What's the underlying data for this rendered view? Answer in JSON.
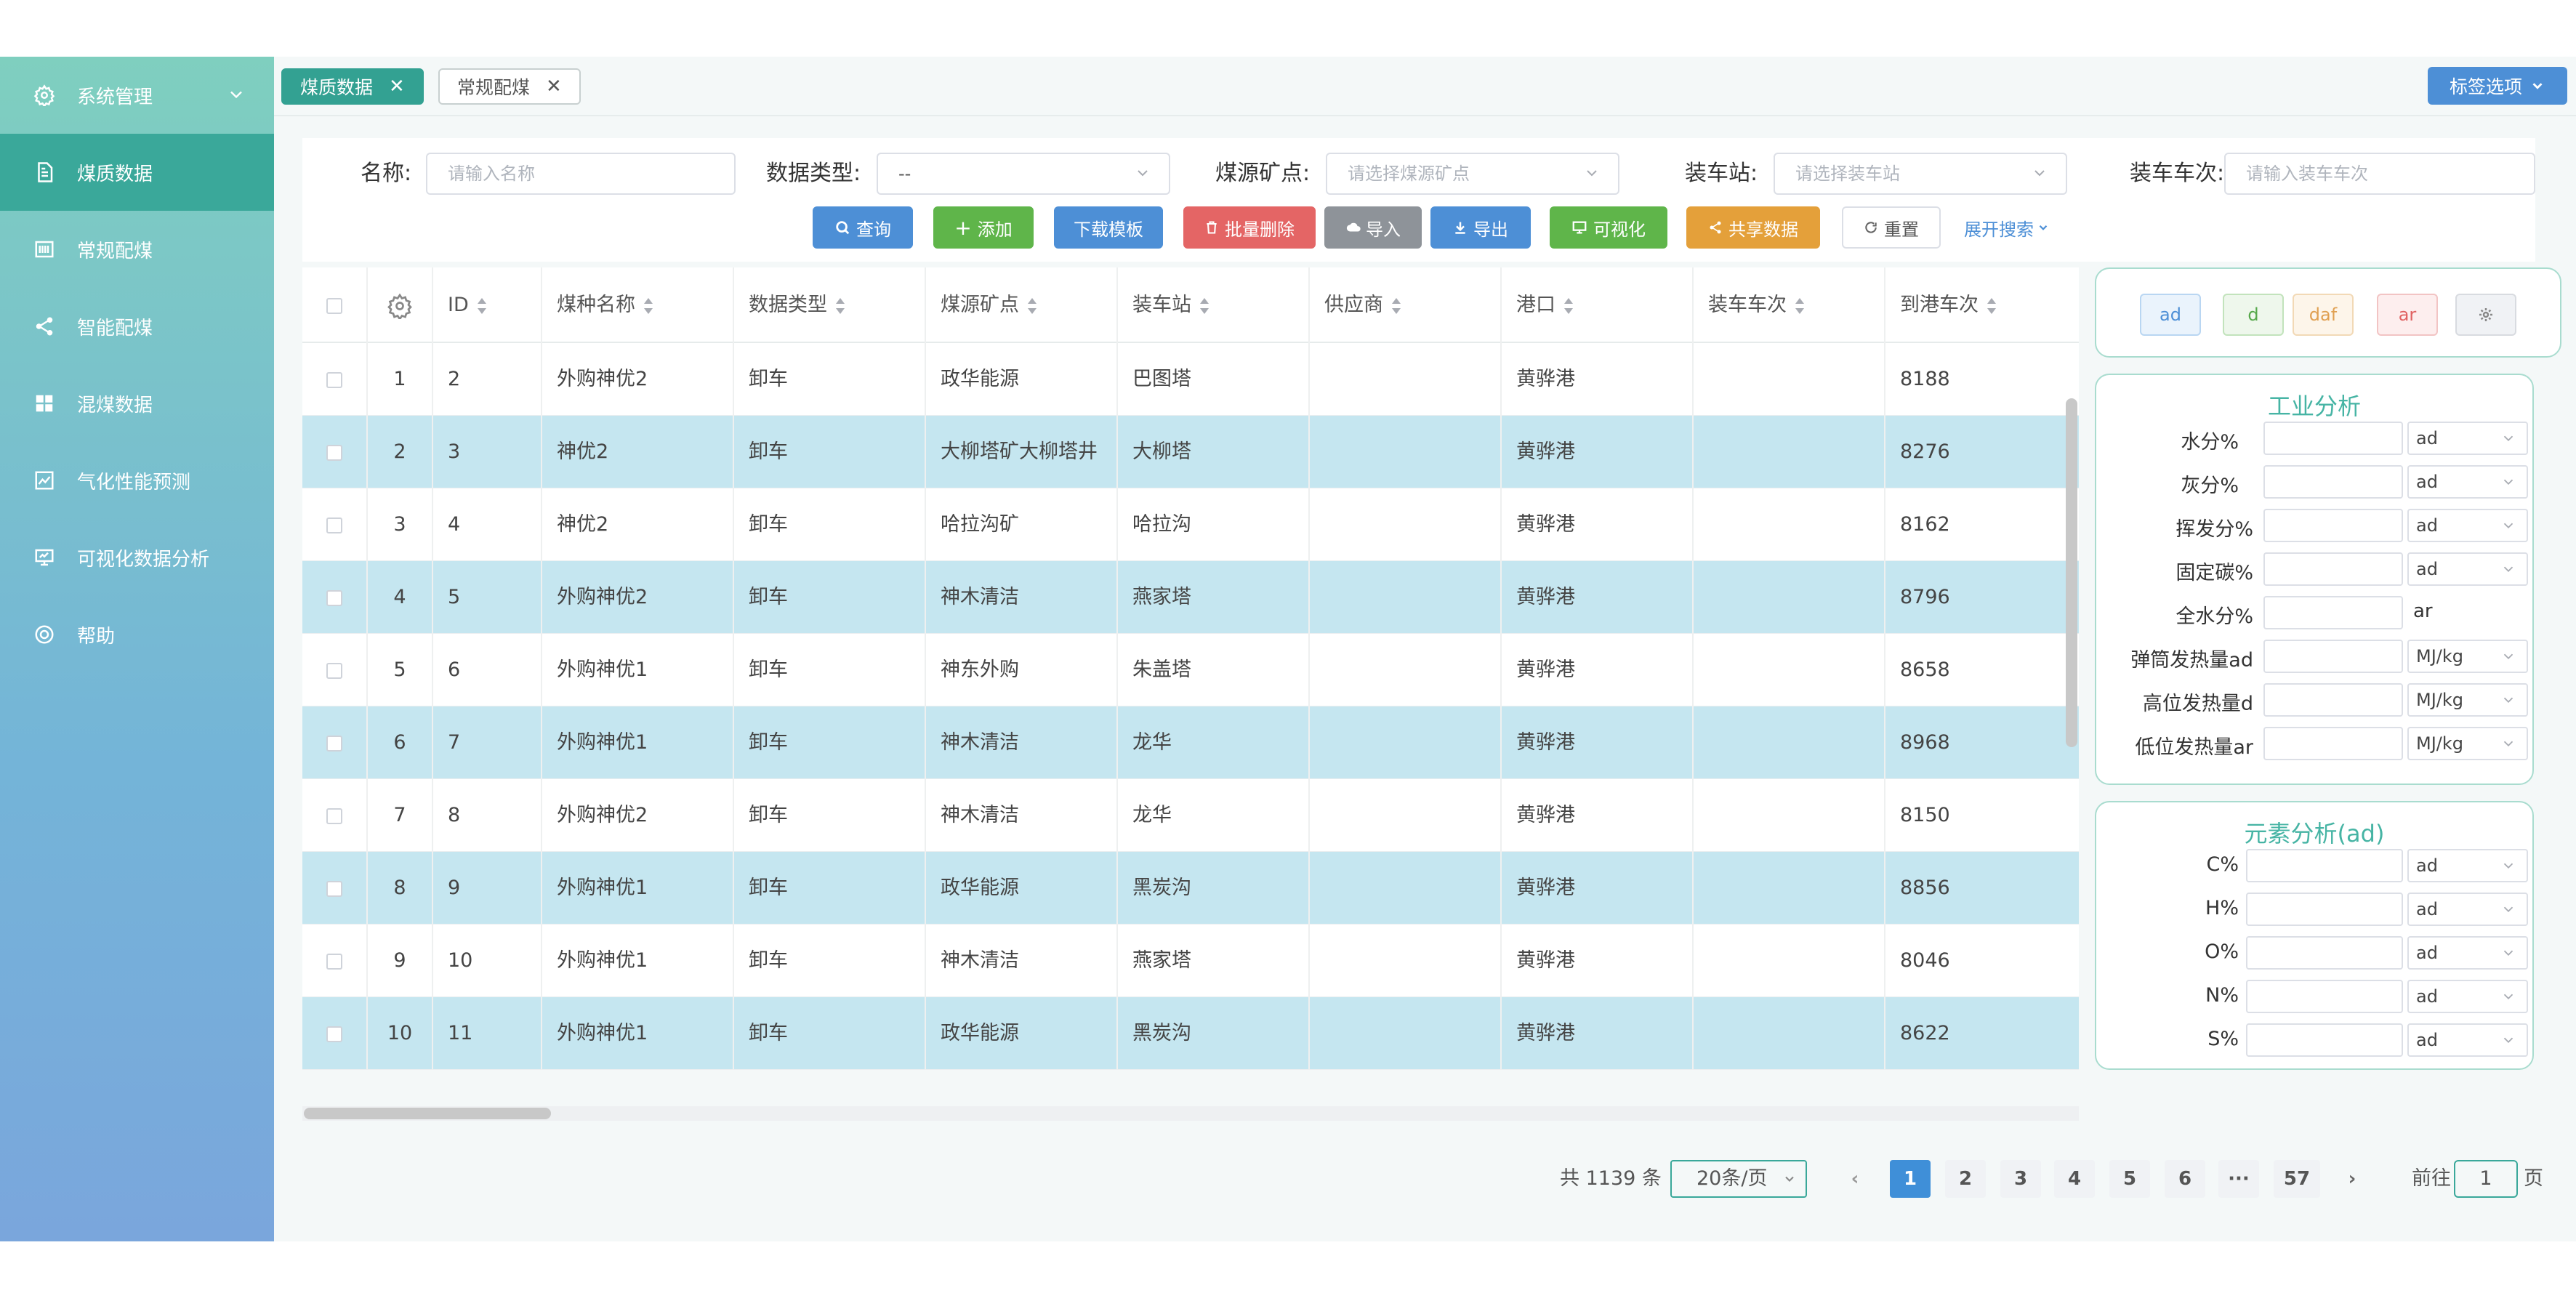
{
  "sidebar": {
    "items": [
      {
        "label": "系统管理",
        "icon": "gear-icon",
        "active": false
      },
      {
        "label": "煤质数据",
        "icon": "document-icon",
        "active": true
      },
      {
        "label": "常规配煤",
        "icon": "barcode-icon",
        "active": false
      },
      {
        "label": "智能配煤",
        "icon": "share-icon",
        "active": false
      },
      {
        "label": "混煤数据",
        "icon": "grid-icon",
        "active": false
      },
      {
        "label": "气化性能预测",
        "icon": "chart-icon",
        "active": false
      },
      {
        "label": "可视化数据分析",
        "icon": "monitor-icon",
        "active": false
      },
      {
        "label": "帮助",
        "icon": "help-icon",
        "active": false
      }
    ]
  },
  "tabs": [
    {
      "label": "煤质数据",
      "active": true
    },
    {
      "label": "常规配煤",
      "active": false
    }
  ],
  "tag_options_label": "标签选项",
  "search": {
    "name_label": "名称:",
    "name_placeholder": "请输入名称",
    "type_label": "数据类型:",
    "type_value": "--",
    "mine_label": "煤源矿点:",
    "mine_placeholder": "请选择煤源矿点",
    "station_label": "装车站:",
    "station_placeholder": "请选择装车站",
    "train_label": "装车车次:",
    "train_placeholder": "请输入装车车次"
  },
  "buttons": {
    "query": "查询",
    "add": "添加",
    "download": "下载模板",
    "batch_delete": "批量删除",
    "import": "导入",
    "export": "导出",
    "visualize": "可视化",
    "share": "共享数据",
    "reset": "重置",
    "expand": "展开搜索"
  },
  "table": {
    "headers": [
      "ID",
      "煤种名称",
      "数据类型",
      "煤源矿点",
      "装车站",
      "供应商",
      "港口",
      "装车车次",
      "到港车次"
    ],
    "rows": [
      {
        "idx": "1",
        "id": "2",
        "name": "外购神优2",
        "type": "卸车",
        "mine": "政华能源",
        "station": "巴图塔",
        "supplier": "",
        "port": "黄骅港",
        "train": "",
        "arrival": "8188"
      },
      {
        "idx": "2",
        "id": "3",
        "name": "神优2",
        "type": "卸车",
        "mine": "大柳塔矿大柳塔井",
        "station": "大柳塔",
        "supplier": "",
        "port": "黄骅港",
        "train": "",
        "arrival": "8276"
      },
      {
        "idx": "3",
        "id": "4",
        "name": "神优2",
        "type": "卸车",
        "mine": "哈拉沟矿",
        "station": "哈拉沟",
        "supplier": "",
        "port": "黄骅港",
        "train": "",
        "arrival": "8162"
      },
      {
        "idx": "4",
        "id": "5",
        "name": "外购神优2",
        "type": "卸车",
        "mine": "神木清洁",
        "station": "燕家塔",
        "supplier": "",
        "port": "黄骅港",
        "train": "",
        "arrival": "8796"
      },
      {
        "idx": "5",
        "id": "6",
        "name": "外购神优1",
        "type": "卸车",
        "mine": "神东外购",
        "station": "朱盖塔",
        "supplier": "",
        "port": "黄骅港",
        "train": "",
        "arrival": "8658"
      },
      {
        "idx": "6",
        "id": "7",
        "name": "外购神优1",
        "type": "卸车",
        "mine": "神木清洁",
        "station": "龙华",
        "supplier": "",
        "port": "黄骅港",
        "train": "",
        "arrival": "8968"
      },
      {
        "idx": "7",
        "id": "8",
        "name": "外购神优2",
        "type": "卸车",
        "mine": "神木清洁",
        "station": "龙华",
        "supplier": "",
        "port": "黄骅港",
        "train": "",
        "arrival": "8150"
      },
      {
        "idx": "8",
        "id": "9",
        "name": "外购神优1",
        "type": "卸车",
        "mine": "政华能源",
        "station": "黑炭沟",
        "supplier": "",
        "port": "黄骅港",
        "train": "",
        "arrival": "8856"
      },
      {
        "idx": "9",
        "id": "10",
        "name": "外购神优1",
        "type": "卸车",
        "mine": "神木清洁",
        "station": "燕家塔",
        "supplier": "",
        "port": "黄骅港",
        "train": "",
        "arrival": "8046"
      },
      {
        "idx": "10",
        "id": "11",
        "name": "外购神优1",
        "type": "卸车",
        "mine": "政华能源",
        "station": "黑炭沟",
        "supplier": "",
        "port": "黄骅港",
        "train": "",
        "arrival": "8622"
      }
    ]
  },
  "pagination": {
    "total": "共 1139 条",
    "page_size": "20条/页",
    "pages": [
      "1",
      "2",
      "3",
      "4",
      "5",
      "6",
      "···",
      "57"
    ],
    "current": "1",
    "goto_label": "前往",
    "goto_value": "1",
    "page_suffix": "页"
  },
  "basis_buttons": [
    {
      "label": "ad",
      "color": "#4d8fd6",
      "bg": "#eaf3fc",
      "border": "#b9d6f2"
    },
    {
      "label": "d",
      "color": "#55a84a",
      "bg": "#eef7ec",
      "border": "#c2e3bc"
    },
    {
      "label": "daf",
      "color": "#e0a052",
      "bg": "#fdf5ea",
      "border": "#f2d9b6"
    },
    {
      "label": "ar",
      "color": "#e06262",
      "bg": "#fdeeee",
      "border": "#f2c4c4"
    }
  ],
  "industrial": {
    "title": "工业分析",
    "rows": [
      {
        "label": "水分%",
        "unit": "ad",
        "select": true
      },
      {
        "label": "灰分%",
        "unit": "ad",
        "select": true
      },
      {
        "label": "挥发分%",
        "unit": "ad",
        "select": true
      },
      {
        "label": "固定碳%",
        "unit": "ad",
        "select": true
      },
      {
        "label": "全水分%",
        "unit": "ar",
        "select": false
      },
      {
        "label": "弹筒发热量ad",
        "unit": "MJ/kg",
        "select": true
      },
      {
        "label": "高位发热量d",
        "unit": "MJ/kg",
        "select": true
      },
      {
        "label": "低位发热量ar",
        "unit": "MJ/kg",
        "select": true
      }
    ]
  },
  "element": {
    "title": "元素分析(ad)",
    "rows": [
      {
        "label": "C%",
        "unit": "ad"
      },
      {
        "label": "H%",
        "unit": "ad"
      },
      {
        "label": "O%",
        "unit": "ad"
      },
      {
        "label": "N%",
        "unit": "ad"
      },
      {
        "label": "S%",
        "unit": "ad"
      }
    ]
  }
}
